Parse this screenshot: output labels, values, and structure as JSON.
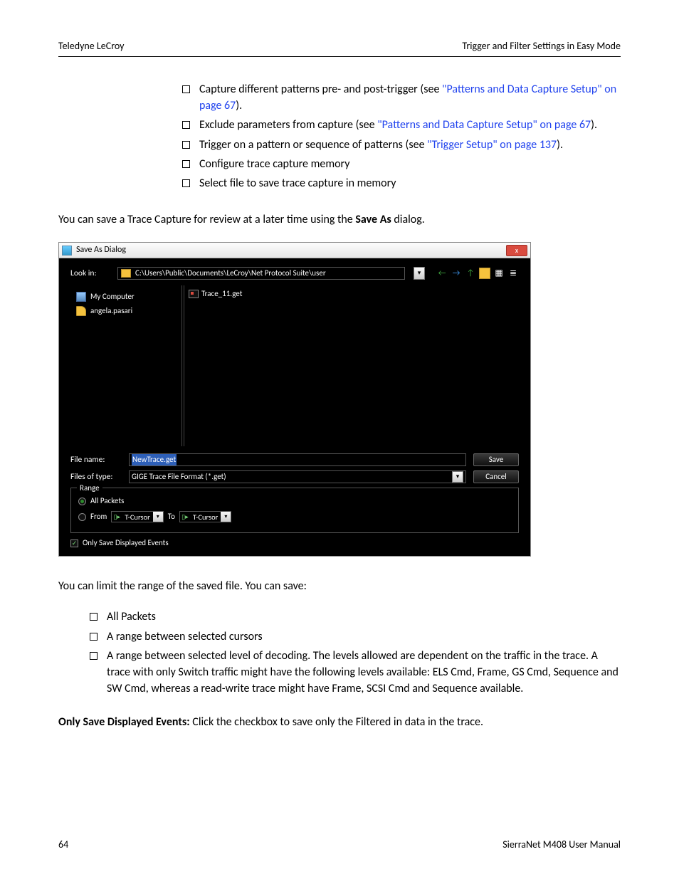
{
  "header": {
    "left": "Teledyne LeCroy",
    "right": "Trigger and Filter Settings in Easy Mode"
  },
  "list1": [
    {
      "pre": "Capture different patterns pre- and post-trigger (see ",
      "link": "\"Patterns and Data Capture Setup\" on page 67",
      "post": ")."
    },
    {
      "pre": "Exclude parameters from capture (see ",
      "link": "\"Patterns and Data Capture Setup\" on page 67",
      "post": ")."
    },
    {
      "pre": "Trigger on a pattern or sequence of patterns (see ",
      "link": "\"Trigger Setup\" on page 137",
      "post": ")."
    },
    {
      "pre": "Configure trace capture memory",
      "link": "",
      "post": ""
    },
    {
      "pre": "Select file to save trace capture in memory",
      "link": "",
      "post": ""
    }
  ],
  "para1_a": "You can save a Trace Capture for review at a later time using the ",
  "para1_b": "Save As",
  "para1_c": " dialog.",
  "dialog": {
    "title": "Save As Dialog",
    "close": "x",
    "lookin_label": "Look in:",
    "path": "C:\\Users\\Public\\Documents\\LeCroy\\Net Protocol Suite\\user",
    "sidebar_mycomp": "My Computer",
    "sidebar_user": "angela.pasari",
    "file": "Trace_11.get",
    "filename_label": "File name:",
    "filename_value": "NewTrace.get",
    "filetype_label": "Files of type:",
    "filetype_value": "GIGE Trace File Format (*.get)",
    "save": "Save",
    "cancel": "Cancel",
    "range_legend": "Range",
    "all_packets": "All Packets",
    "from": "From",
    "to": "To",
    "cursor": "T-Cursor",
    "only_save": "Only Save Displayed Events"
  },
  "para2": "You can limit the range of the saved file. You can save:",
  "list2": [
    "All Packets",
    "A range between selected cursors",
    "A range between selected level of decoding. The levels allowed are dependent on the traffic in the trace. A trace with only Switch traffic might have the following levels available: ELS Cmd, Frame, GS Cmd, Sequence and SW Cmd, whereas a read-write trace might have Frame, SCSI Cmd and Sequence available."
  ],
  "para3_a": "Only Save Displayed Events:",
  "para3_b": " Click the checkbox to save only the Filtered in data in the trace.",
  "footer": {
    "page": "64",
    "doc": "SierraNet M408 User Manual"
  }
}
